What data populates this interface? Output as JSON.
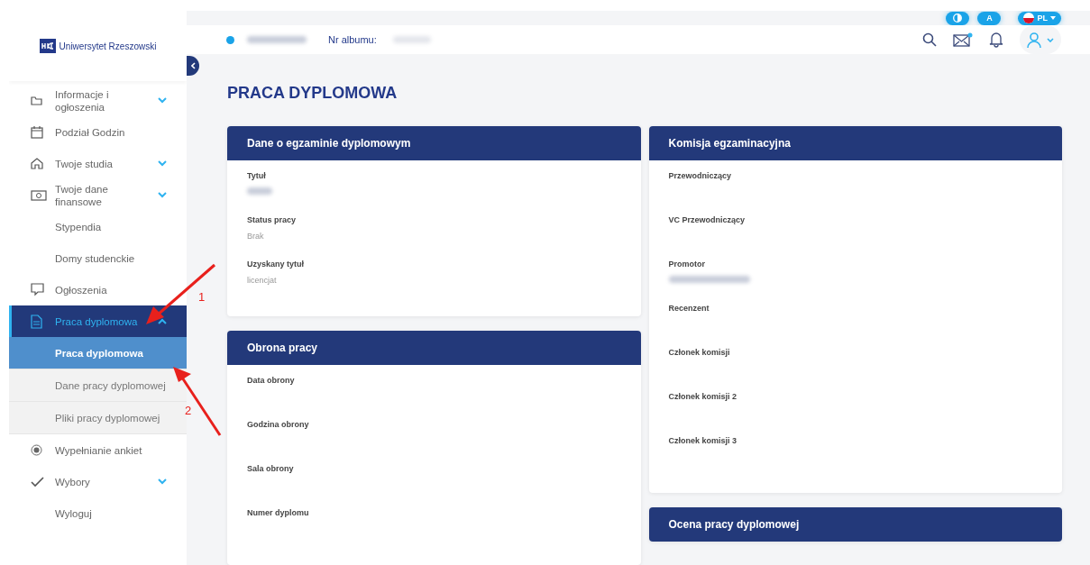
{
  "logo": {
    "text": "Uniwersytet Rzeszowski"
  },
  "toolbar": {
    "pills": [
      {
        "kind": "contrast"
      },
      {
        "kind": "text",
        "label": "A"
      },
      {
        "kind": "lang",
        "label": "PL"
      }
    ]
  },
  "header": {
    "user_redacted": true,
    "album_label": "Nr albumu:",
    "album_redacted": true
  },
  "sidebar": {
    "items": [
      {
        "label": "Informacje i ogłoszenia",
        "expanded": false,
        "selected": false
      },
      {
        "label": "Podział Godzin",
        "selected": false
      },
      {
        "label": "Twoje studia",
        "expanded": false,
        "selected": false
      },
      {
        "label": "Twoje dane finansowe",
        "expanded": false,
        "selected": false
      },
      {
        "label": "Stypendia",
        "selected": false
      },
      {
        "label": "Domy studenckie",
        "selected": false
      },
      {
        "label": "Ogłoszenia",
        "selected": false
      },
      {
        "label": "Praca dyplomowa",
        "expanded": true,
        "selected": true,
        "children": [
          {
            "label": "Praca dyplomowa",
            "selected": true
          },
          {
            "label": "Dane pracy dyplomowej",
            "selected": false
          },
          {
            "label": "Pliki pracy dyplomowej",
            "selected": false
          }
        ]
      },
      {
        "label": "Wypełnianie ankiet",
        "selected": false
      },
      {
        "label": "Wybory",
        "expanded": false,
        "selected": false
      },
      {
        "label": "Wyloguj",
        "selected": false
      }
    ]
  },
  "page_title": "PRACA DYPLOMOWA",
  "columns": [
    [
      {
        "title": "Dane o egzaminie dyplomowym",
        "fields": [
          {
            "label": "Tytuł",
            "redacted": true
          },
          {
            "label": "Status pracy",
            "value": "Brak"
          },
          {
            "label": "Uzyskany tytuł",
            "value": "licencjat"
          }
        ]
      },
      {
        "title": "Obrona pracy",
        "fields": [
          {
            "label": "Data obrony"
          },
          {
            "label": "Godzina obrony"
          },
          {
            "label": "Sala obrony"
          },
          {
            "label": "Numer dyplomu"
          }
        ]
      }
    ],
    [
      {
        "title": "Komisja egzaminacyjna",
        "fields": [
          {
            "label": "Przewodniczący"
          },
          {
            "label": "VC Przewodniczący"
          },
          {
            "label": "Promotor",
            "redacted": true
          },
          {
            "label": "Recenzent"
          },
          {
            "label": "Członek komisji"
          },
          {
            "label": "Członek komisji 2"
          },
          {
            "label": "Członek komisji 3"
          }
        ]
      },
      {
        "title": "Ocena pracy dyplomowej"
      }
    ]
  ],
  "annotations": [
    {
      "label": "1",
      "kind": "arrow-left"
    },
    {
      "label": "2",
      "kind": "arrow-up"
    }
  ]
}
